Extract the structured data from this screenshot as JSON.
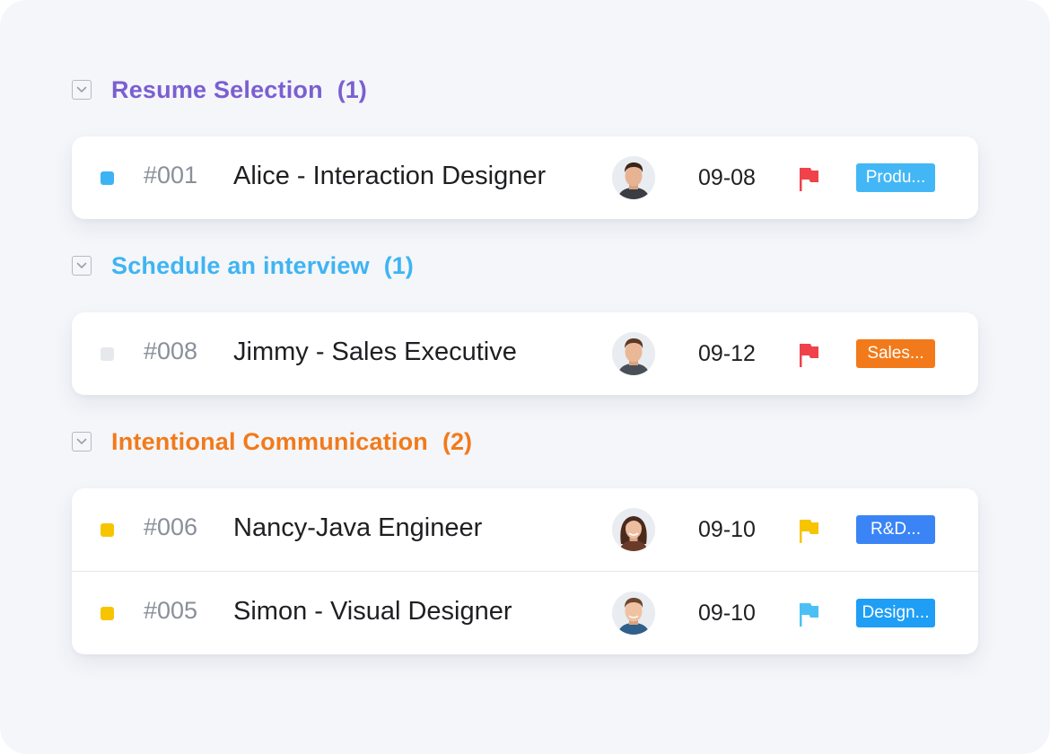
{
  "groups": [
    {
      "title": "Resume Selection",
      "count": "(1)",
      "color": "#7b5fd0",
      "rows": [
        {
          "id": "#001",
          "title": "Alice - Interaction Designer",
          "date": "09-08",
          "dot_color": "#3db3f5",
          "flag_color": "#f0424b",
          "tag": "Produ...",
          "tag_color": "#43b7f5",
          "avatar": "male-avatar"
        }
      ]
    },
    {
      "title": "Schedule an interview",
      "count": "(1)",
      "color": "#3fb4f2",
      "rows": [
        {
          "id": "#008",
          "title": "Jimmy - Sales Executive",
          "date": "09-12",
          "dot_color": "#e6e8ec",
          "flag_color": "#f0424b",
          "tag": "Sales...",
          "tag_color": "#f27a1a",
          "avatar": "male-avatar"
        }
      ]
    },
    {
      "title": "Intentional Communication",
      "count": "(2)",
      "color": "#f27a1a",
      "rows": [
        {
          "id": "#006",
          "title": "Nancy-Java Engineer",
          "date": "09-10",
          "dot_color": "#f7c400",
          "flag_color": "#f7c400",
          "tag": "R&D...",
          "tag_color": "#3a84f6",
          "avatar": "female-avatar"
        },
        {
          "id": "#005",
          "title": "Simon - Visual Designer",
          "date": "09-10",
          "dot_color": "#f7c400",
          "flag_color": "#4cc0f5",
          "tag": "Design...",
          "tag_color": "#1e9ef5",
          "avatar": "male-avatar"
        }
      ]
    }
  ]
}
